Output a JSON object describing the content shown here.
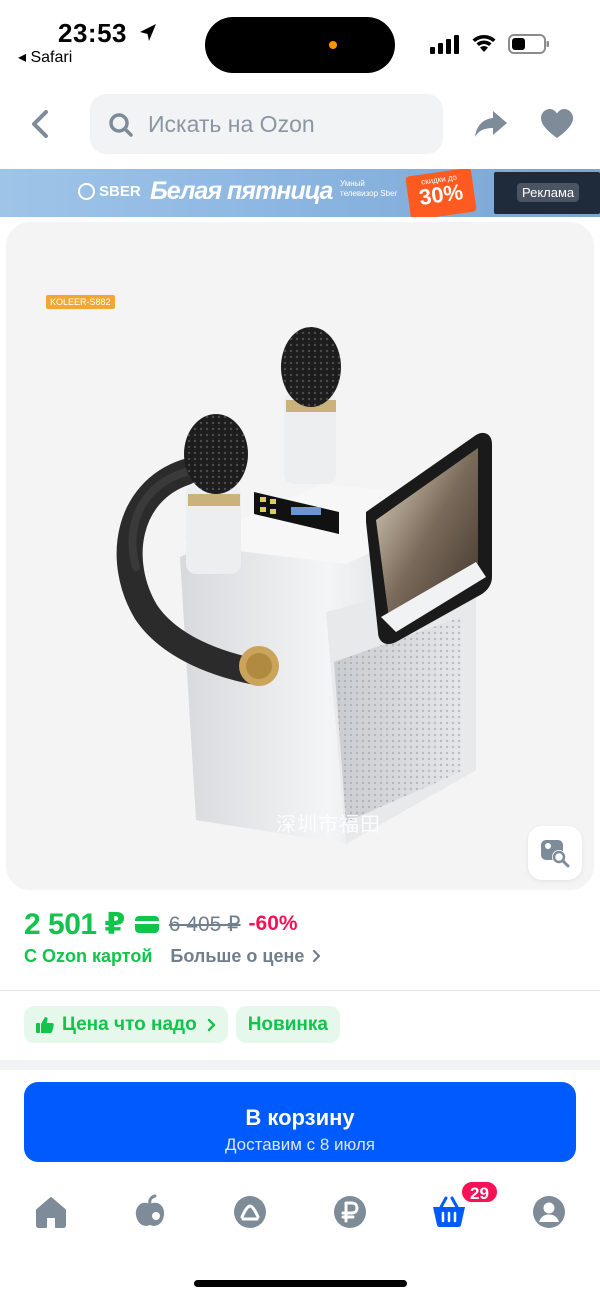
{
  "status_bar": {
    "time": "23:53",
    "back_app": "◂ Safari"
  },
  "search": {
    "placeholder": "Искать на Ozon"
  },
  "banner": {
    "brand": "SBER",
    "title": "Белая пятница",
    "subtitle": "Умный телевизор Sber",
    "sale_small": "скидки до",
    "sale_big": "30%",
    "ad_label": "Реклама"
  },
  "product": {
    "model_tag": "KOLEER-S882",
    "watermark": "深圳市福田"
  },
  "price": {
    "current": "2 501 ₽",
    "old": "6 405 ₽",
    "discount": "-60%",
    "with_card": "С Ozon картой",
    "more_about_price": "Больше о цене"
  },
  "badges": [
    {
      "label": "Цена что надо"
    },
    {
      "label": "Новинка"
    }
  ],
  "cart": {
    "label": "В корзину",
    "delivery": "Доставим с 8 июля"
  },
  "bottom_nav": {
    "cart_count": "29",
    "items": [
      "home-icon",
      "fresh-icon",
      "hint-icon",
      "ruble-icon",
      "cart-icon",
      "profile-icon"
    ]
  },
  "colors": {
    "accent_blue": "#005bff",
    "price_green": "#10c44c",
    "discount_pink": "#f91155",
    "icon_gray": "#8a96a3"
  }
}
